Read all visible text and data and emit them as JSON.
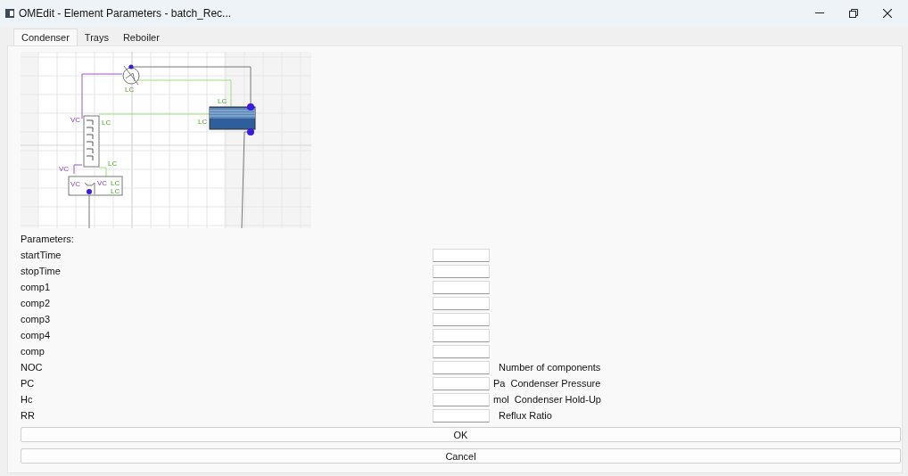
{
  "window": {
    "title": "OMEdit - Element Parameters - batch_Rec..."
  },
  "tabs": [
    {
      "label": "Condenser",
      "selected": true
    },
    {
      "label": "Trays",
      "selected": false
    },
    {
      "label": "Reboiler",
      "selected": false
    }
  ],
  "diagram": {
    "labels": [
      "LC",
      "VC",
      "LC",
      "LC",
      "LC",
      "VC",
      "LC",
      "VC",
      "VC",
      "LC",
      "LC"
    ]
  },
  "section_label": "Parameters:",
  "parameters": [
    {
      "name": "startTime"
    },
    {
      "name": "stopTime"
    },
    {
      "name": "comp1"
    },
    {
      "name": "comp2"
    },
    {
      "name": "comp3"
    },
    {
      "name": "comp4"
    },
    {
      "name": "comp"
    },
    {
      "name": "NOC",
      "description": "Number of components"
    },
    {
      "name": "PC",
      "unit": "Pa",
      "description": "Condenser Pressure"
    },
    {
      "name": "Hc",
      "unit": "mol",
      "description": "Condenser Hold-Up"
    },
    {
      "name": "RR",
      "description": "Reflux Ratio"
    }
  ],
  "buttons": [
    "OK",
    "Cancel"
  ]
}
